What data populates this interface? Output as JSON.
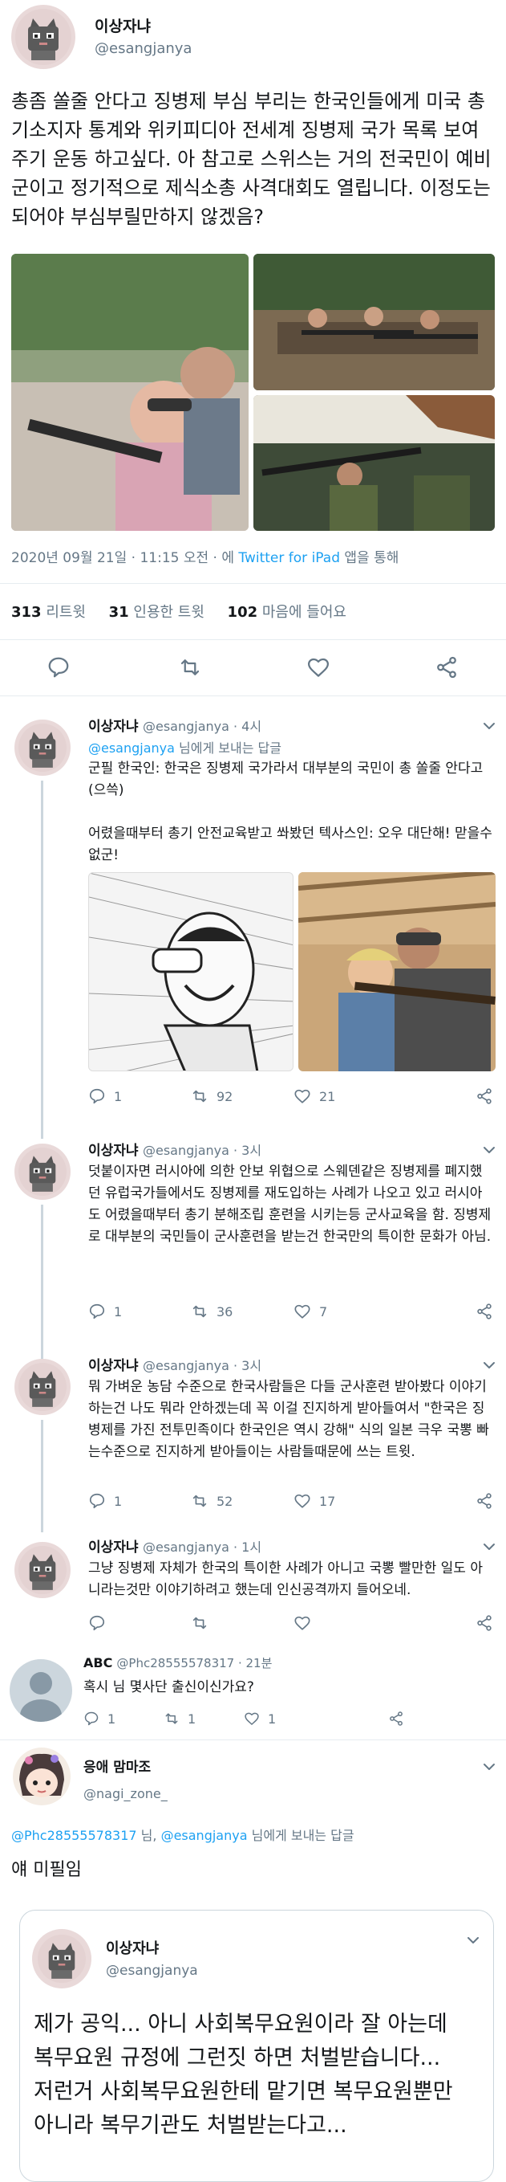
{
  "main": {
    "user_name": "이상자냐",
    "user_handle": "@esangjanya",
    "text": "총좀 쏠줄 안다고 징병제 부심 부리는 한국인들에게 미국 총기소지자 통계와 위키피디아 전세계 징병제 국가 목록 보여주기 운동 하고싶다. 아 참고로 스위스는 거의 전국민이 예비군이고 정기적으로 제식소총 사격대회도 열립니다. 이정도는 되어야 부심부릴만하지 않겠음?",
    "timestamp": "2020년 09월 21일 · 11:15 오전 · 에",
    "client": "Twitter for iPad",
    "client_suffix": "앱을 통해",
    "stats": {
      "retweets_num": "313",
      "retweets_lbl": "리트윗",
      "quotes_num": "31",
      "quotes_lbl": "인용한 트윗",
      "likes_num": "102",
      "likes_lbl": "마음에 들어요"
    }
  },
  "replies": [
    {
      "user_name": "이상자냐",
      "user_handle": "@esangjanya · 4시",
      "replying_handle": "@esangjanya",
      "replying_suffix": "님에게 보내는 답글",
      "text": "군필 한국인: 한국은 징병제 국가라서 대부분의 국민이 총 쏠줄 안다고(으쓱)\n\n어렸을때부터 총기 안전교육받고 쏴봤던 텍사스인: 오우 대단해! 맏을수 없군!",
      "replies": "1",
      "retweets": "92",
      "likes": "21"
    },
    {
      "user_name": "이상자냐",
      "user_handle": "@esangjanya · 3시",
      "text": "덧붙이자면 러시아에 의한 안보 위협으로 스웨덴같은 징병제를 폐지했던 유럽국가들에서도 징병제를 재도입하는 사례가 나오고 있고 러시아도 어렸을때부터 총기 분해조립 훈련을 시키는등 군사교육을 함. 징병제로 대부분의 국민들이 군사훈련을 받는건 한국만의 특이한 문화가 아님.",
      "replies": "1",
      "retweets": "36",
      "likes": "7"
    },
    {
      "user_name": "이상자냐",
      "user_handle": "@esangjanya · 3시",
      "text": "뭐 가벼운 농담 수준으로 한국사람들은 다들 군사훈련 받아봤다 이야기하는건 나도 뭐라 안하겠는데 꼭 이걸 진지하게 받아들여서 \"한국은 징병제를 가진 전투민족이다 한국인은 역시 강해\" 식의 일본 극우 국뽕 빠는수준으로 진지하게 받아들이는 사람들때문에 쓰는 트윗.",
      "replies": "1",
      "retweets": "52",
      "likes": "17"
    },
    {
      "user_name": "이상자냐",
      "user_handle": "@esangjanya · 1시",
      "text": "그냥 징병제 자체가 한국의 특이한 사례가 아니고 국뽕 빨만한 일도 아니라는것만 이야기하려고 했는데 인신공격까지 들어오네.",
      "replies": "",
      "retweets": "",
      "likes": ""
    }
  ],
  "abc_reply": {
    "user_name": "ABC",
    "user_handle": "@Phc28555578317 · 21분",
    "text": "혹시 님 몇사단 출신이신가요?",
    "replies": "1",
    "retweets": "1",
    "likes": "1"
  },
  "nagi": {
    "user_name": "응애 맘마조",
    "user_handle": "@nagi_zone_",
    "replying_to_1": "@Phc28555578317",
    "replying_mid": "님,",
    "replying_to_2": "@esangjanya",
    "replying_suffix": "님에게 보내는 답글",
    "text": "얘 미필임"
  },
  "quote": {
    "user_name": "이상자냐",
    "user_handle": "@esangjanya",
    "text": "제가 공익... 아니 사회복무요원이라 잘 아는데 복무요원 규정에 그런짓 하면 처벌받습니다... 저런거 사회복무요원한테 맡기면 복무요원뿐만 아니라 복무기관도 처벌받는다고..."
  },
  "colors": {
    "accent": "#1da1f2",
    "muted": "#657786",
    "text": "#14171a",
    "divider": "#e6ecf0"
  }
}
